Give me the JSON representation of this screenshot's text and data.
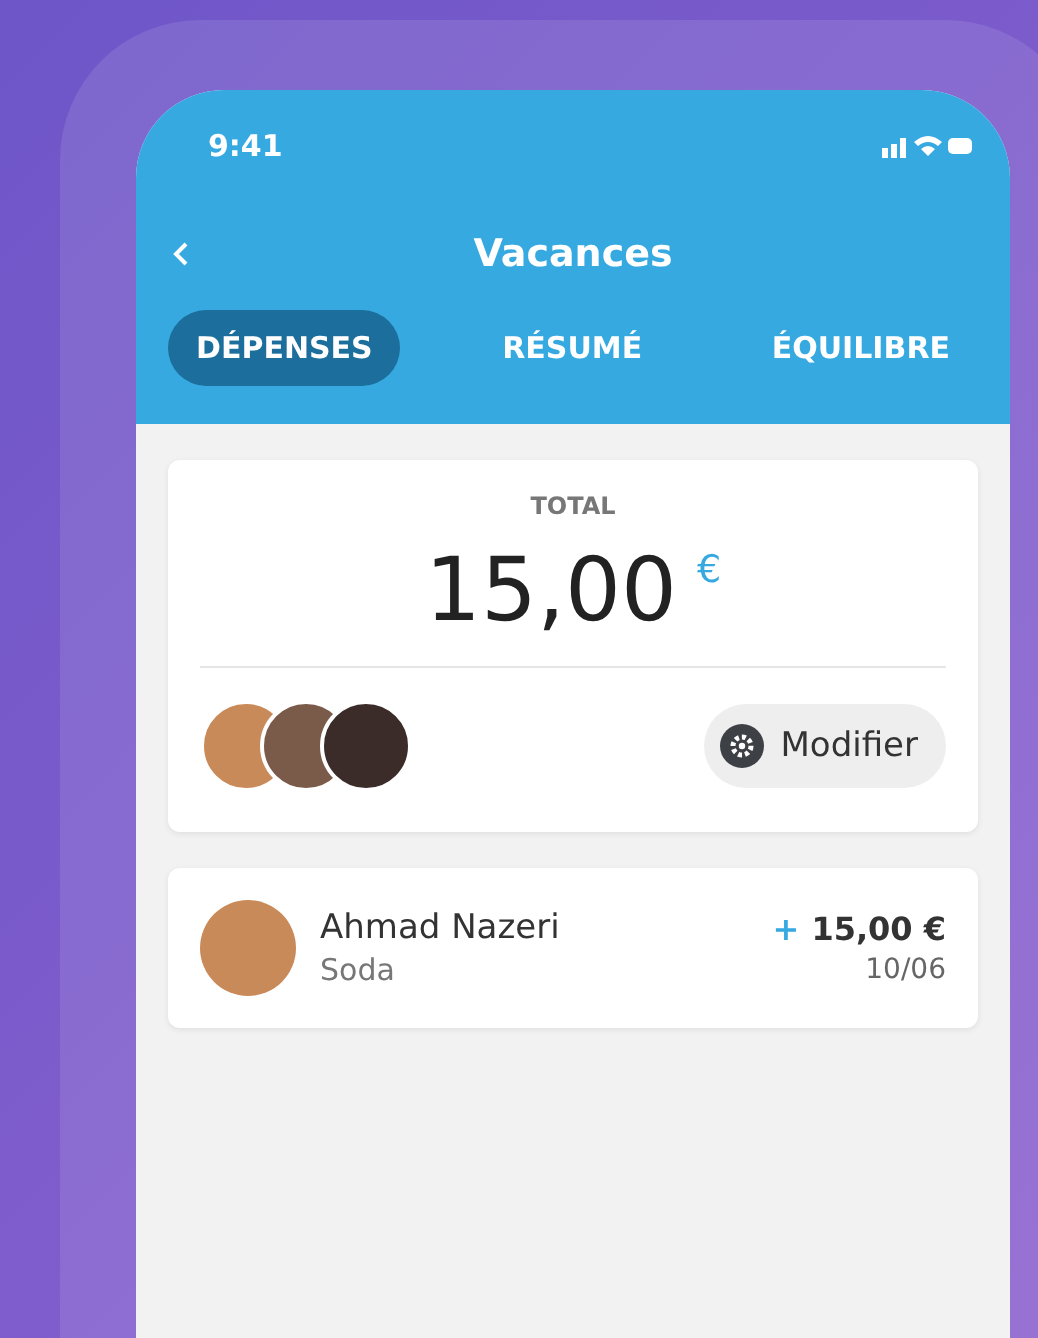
{
  "status_bar": {
    "time": "9:41"
  },
  "header": {
    "title": "Vacances"
  },
  "tabs": [
    {
      "label": "DÉPENSES",
      "selected": true
    },
    {
      "label": "RÉSUMÉ",
      "selected": false
    },
    {
      "label": "ÉQUILIBRE",
      "selected": false
    }
  ],
  "total": {
    "label": "TOTAL",
    "amount": "15,00",
    "currency": "€"
  },
  "participants": [
    {
      "color": "#c98a5a"
    },
    {
      "color": "#7a5a48"
    },
    {
      "color": "#3b2c2a"
    }
  ],
  "edit_button": {
    "label": "Modifier"
  },
  "expenses": [
    {
      "name": "Ahmad Nazeri",
      "description": "Soda",
      "sign": "+",
      "amount": "15,00 €",
      "date": "10/06",
      "color": "#c98a5a"
    }
  ]
}
